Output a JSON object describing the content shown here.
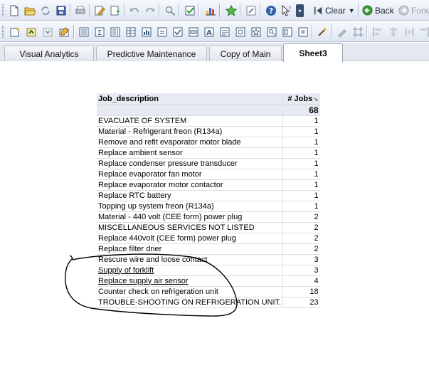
{
  "toolbar1": {
    "clear_label": "Clear",
    "back_label": "Back",
    "forward_label": "Forw"
  },
  "tabs": [
    {
      "label": "Visual Analytics"
    },
    {
      "label": "Predictive Maintenance"
    },
    {
      "label": "Copy of Main"
    },
    {
      "label": "Sheet3"
    }
  ],
  "active_tab": "Sheet3",
  "table": {
    "headers": [
      "Job_description",
      "# Jobs"
    ],
    "total": "68",
    "rows": [
      {
        "desc": "EVACUATE OF SYSTEM",
        "jobs": "1"
      },
      {
        "desc": "Material - Refrigerant freon (R134a)",
        "jobs": "1"
      },
      {
        "desc": "Remove and refit evaporator motor blade",
        "jobs": "1"
      },
      {
        "desc": "Replace ambient sensor",
        "jobs": "1"
      },
      {
        "desc": "Replace condenser pressure transducer",
        "jobs": "1"
      },
      {
        "desc": "Replace evaporator fan motor",
        "jobs": "1"
      },
      {
        "desc": "Replace evaporator motor contactor",
        "jobs": "1"
      },
      {
        "desc": "Replace RTC battery",
        "jobs": "1"
      },
      {
        "desc": "Topping up system freon (R134a)",
        "jobs": "1"
      },
      {
        "desc": "Material - 440 volt (CEE form) power plug",
        "jobs": "2"
      },
      {
        "desc": "MISCELLANEOUS SERVICES NOT LISTED",
        "jobs": "2"
      },
      {
        "desc": "Replace 440volt (CEE form) power plug",
        "jobs": "2"
      },
      {
        "desc": "Replace filter drier",
        "jobs": "2"
      },
      {
        "desc": "Rescure wire and loose contact",
        "jobs": "3"
      },
      {
        "desc": "Supply of forklift",
        "jobs": "3"
      },
      {
        "desc": "Replace supply air sensor",
        "jobs": "4"
      },
      {
        "desc": "Counter check on refrigeration unit",
        "jobs": "18"
      },
      {
        "desc": "TROUBLE-SHOOTING ON REFRIGERATION UNIT.",
        "jobs": "23"
      }
    ]
  },
  "colors": {
    "toolbar_bg": "#dfe6f1",
    "tab_bg": "#e5e8ee",
    "annotation_ink": "#000000"
  }
}
